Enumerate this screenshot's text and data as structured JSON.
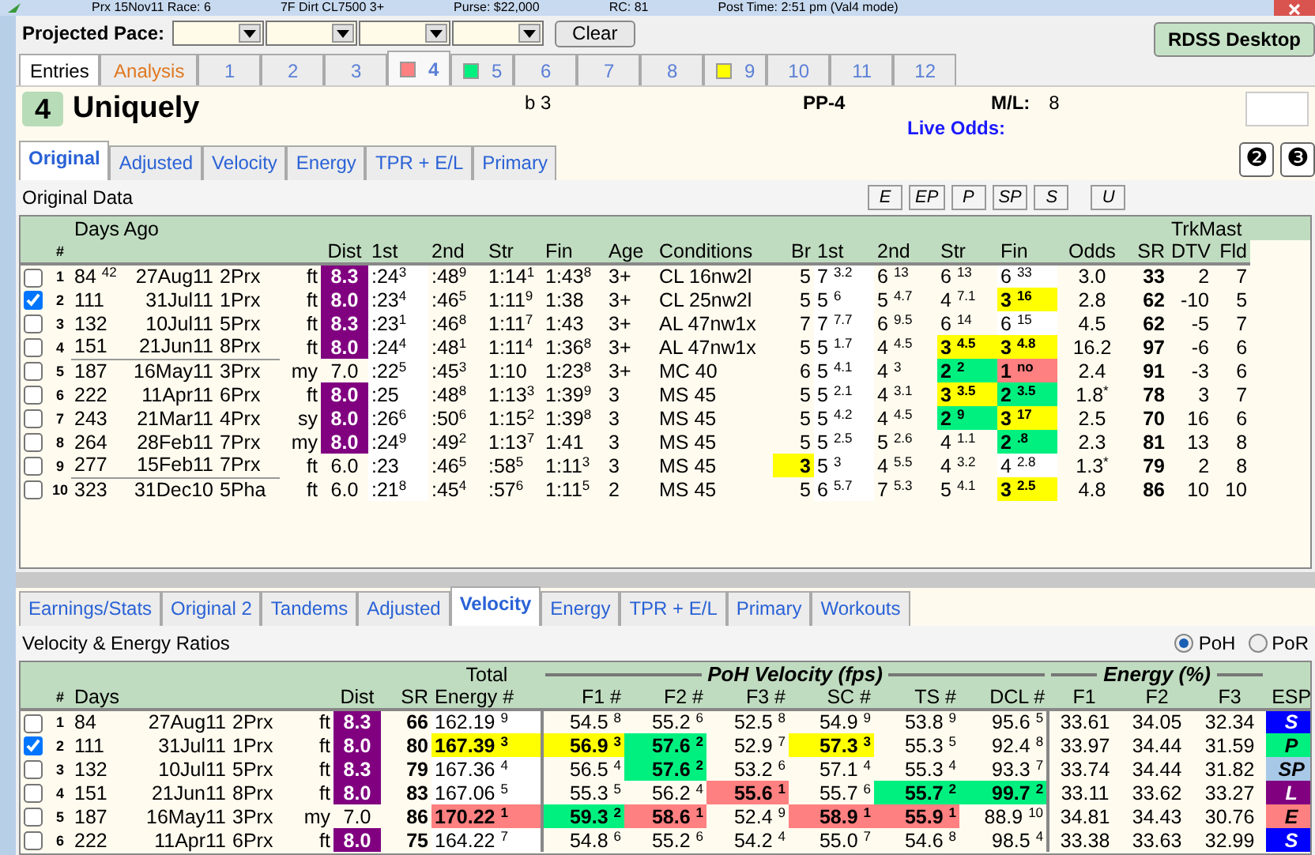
{
  "title_parts": [
    "Prx 15Nov11 Race: 6",
    "7F Dirt  CL7500  3+",
    "Purse: $22,000",
    "RC: 81",
    "Post Time: 2:51 pm  (Val4 mode)"
  ],
  "pace": {
    "label": "Projected Pace:",
    "clear": "Clear"
  },
  "desktop_button": "RDSS Desktop",
  "tabs": [
    {
      "label": "Entries",
      "kind": "plain",
      "selected": false
    },
    {
      "label": "Analysis",
      "kind": "analysis",
      "selected": false
    },
    {
      "label": "1",
      "kind": "horse",
      "selected": false
    },
    {
      "label": "2",
      "kind": "horse",
      "selected": false
    },
    {
      "label": "3",
      "kind": "horse",
      "selected": false
    },
    {
      "label": "4",
      "kind": "horse",
      "selected": true,
      "color": "#ff8080"
    },
    {
      "label": "5",
      "kind": "horse",
      "selected": false,
      "color": "#00f080"
    },
    {
      "label": "6",
      "kind": "horse",
      "selected": false
    },
    {
      "label": "7",
      "kind": "horse",
      "selected": false
    },
    {
      "label": "8",
      "kind": "horse",
      "selected": false
    },
    {
      "label": "9",
      "kind": "horse",
      "selected": false,
      "color": "#ffff00"
    },
    {
      "label": "10",
      "kind": "horse",
      "selected": false
    },
    {
      "label": "11",
      "kind": "horse",
      "selected": false
    },
    {
      "label": "12",
      "kind": "horse",
      "selected": false
    }
  ],
  "horse": {
    "number": "4",
    "name": "Uniquely",
    "sex_age": "b 3",
    "post": "PP-4",
    "ml_label": "M/L:",
    "ml": "8",
    "live_odds_label": "Live Odds:",
    "buttons": [
      "❷",
      "❸"
    ]
  },
  "upper_tabs": [
    {
      "label": "Original",
      "selected": true
    },
    {
      "label": "Adjusted",
      "selected": false
    },
    {
      "label": "Velocity",
      "selected": false
    },
    {
      "label": "Energy",
      "selected": false
    },
    {
      "label": "TPR + E/L",
      "selected": false
    },
    {
      "label": "Primary",
      "selected": false
    }
  ],
  "upper_title": "Original Data",
  "filter_buttons": [
    "E",
    "EP",
    "P",
    "SP",
    "S",
    "U"
  ],
  "upper_table": {
    "days_label": "Days Ago",
    "group_label": "TrkMast",
    "columns": [
      "#",
      "",
      "",
      "",
      "",
      "Dist",
      "1st",
      "2nd",
      "Str",
      "Fin",
      "Age",
      "Conditions",
      "Br",
      "1st",
      "2nd",
      "Str",
      "Fin",
      "Odds",
      "SR",
      "DTV",
      "Fld"
    ],
    "rows": [
      {
        "checked": false,
        "rule_below": false,
        "cells": [
          "1",
          "84 $^{42}$",
          "27Aug11",
          "2Prx",
          "ft",
          {
            "text": "8.3",
            "color": "#800080"
          },
          ":24$^{3}$",
          ":48$^{9}$",
          "1:14$^{1}$",
          "1:43$^{8}$",
          "3+",
          "CL 16nw2l",
          "5",
          "7 $^{3.2}$",
          "6 $^{13}$",
          "6 $^{13}$",
          "6 $^{33}$",
          "3.0",
          "33",
          "2",
          "7"
        ]
      },
      {
        "checked": true,
        "rule_below": false,
        "cells": [
          "2",
          "111",
          "31Jul11",
          "1Prx",
          "ft",
          {
            "text": "8.0",
            "color": "#800080"
          },
          ":23$^{4}$",
          ":46$^{5}$",
          "1:11$^{9}$",
          "1:38",
          "3+",
          "CL 25nw2l",
          "5",
          "5 $^{6}$",
          "5 $^{4.7}$",
          "4 $^{7.1}$",
          {
            "text": "3 $^{16}$",
            "color": "#ffff00"
          },
          "2.8",
          "62",
          "-10",
          "5"
        ]
      },
      {
        "checked": false,
        "rule_below": false,
        "cells": [
          "3",
          "132",
          "10Jul11",
          "5Prx",
          "ft",
          {
            "text": "8.3",
            "color": "#800080"
          },
          ":23$^{1}$",
          ":46$^{8}$",
          "1:11$^{7}$",
          "1:43",
          "3+",
          "AL 47nw1x",
          "7",
          "7 $^{7.7}$",
          "6 $^{9.5}$",
          "6 $^{14}$",
          "6 $^{15}$",
          "4.5",
          "62",
          "-5",
          "7"
        ]
      },
      {
        "checked": false,
        "rule_below": true,
        "cells": [
          "4",
          "151",
          "21Jun11",
          "8Prx",
          "ft",
          {
            "text": "8.0",
            "color": "#800080"
          },
          ":24$^{4}$",
          ":48$^{1}$",
          "1:11$^{4}$",
          "1:36$^{8}$",
          "3+",
          "AL 47nw1x",
          "5",
          "5 $^{1.7}$",
          "4 $^{4.5}$",
          {
            "text": "3 $^{4.5}$",
            "color": "#ffff00"
          },
          {
            "text": "3 $^{4.8}$",
            "color": "#ffff00"
          },
          "16.2",
          "97",
          "-6",
          "6"
        ]
      },
      {
        "checked": false,
        "rule_below": false,
        "cells": [
          "5",
          "187",
          "16May11",
          "3Prx",
          "my",
          "7.0",
          ":22$^{5}$",
          ":45$^{3}$",
          "1:10",
          "1:23$^{8}$",
          "3+",
          "MC 40",
          "6",
          "5 $^{4.1}$",
          "4 $^{3}$",
          {
            "text": "2 $^{2}$",
            "color": "#00f080"
          },
          {
            "text": "1 $^{no}$",
            "color": "#ff8080"
          },
          "2.4",
          "91",
          "-3",
          "6"
        ]
      },
      {
        "checked": false,
        "rule_below": false,
        "cells": [
          "6",
          "222",
          "11Apr11",
          "6Prx",
          "ft",
          {
            "text": "8.0",
            "color": "#800080"
          },
          ":25",
          ":48$^{8}$",
          "1:13$^{3}$",
          "1:39$^{9}$",
          "3",
          "MS 45",
          "5",
          "5 $^{2.1}$",
          "4 $^{3.1}$",
          {
            "text": "3 $^{3.5}$",
            "color": "#ffff00"
          },
          {
            "text": "2 $^{3.5}$",
            "color": "#00f080"
          },
          "1.8$^{*}$",
          "78",
          "3",
          "7"
        ]
      },
      {
        "checked": false,
        "rule_below": false,
        "cells": [
          "7",
          "243",
          "21Mar11",
          "4Prx",
          "sy",
          {
            "text": "8.0",
            "color": "#800080"
          },
          ":26$^{6}$",
          ":50$^{6}$",
          "1:15$^{2}$",
          "1:39$^{8}$",
          "3",
          "MS 45",
          "5",
          "5 $^{4.2}$",
          "4 $^{4.5}$",
          {
            "text": "2 $^{9}$",
            "color": "#00f080"
          },
          {
            "text": "3 $^{17}$",
            "color": "#ffff00"
          },
          "2.5",
          "70",
          "16",
          "6"
        ]
      },
      {
        "checked": false,
        "rule_below": false,
        "cells": [
          "8",
          "264",
          "28Feb11",
          "7Prx",
          "my",
          {
            "text": "8.0",
            "color": "#800080"
          },
          ":24$^{9}$",
          ":49$^{2}$",
          "1:13$^{7}$",
          "1:41",
          "3",
          "MS 45",
          "5",
          "5 $^{2.5}$",
          "5 $^{2.6}$",
          "4 $^{1.1}$",
          {
            "text": "2 $^{.8}$",
            "color": "#00f080"
          },
          "2.3",
          "81",
          "13",
          "8"
        ]
      },
      {
        "checked": false,
        "rule_below": true,
        "cells": [
          "9",
          "277",
          "15Feb11",
          "7Prx",
          "ft",
          "6.0",
          ":23",
          ":46$^{5}$",
          ":58$^{5}$",
          "1:11$^{3}$",
          "3",
          "MS 45",
          {
            "text": "3",
            "color": "#ffff00"
          },
          "5 $^{3}$",
          "4 $^{5.5}$",
          "4 $^{3.2}$",
          "4 $^{2.8}$",
          "1.3$^{*}$",
          "79",
          "2",
          "8"
        ]
      },
      {
        "checked": false,
        "rule_below": false,
        "cells": [
          "10",
          "323",
          "31Dec10",
          "5Pha",
          "ft",
          "6.0",
          ":21$^{8}$",
          ":45$^{4}$",
          ":57$^{6}$",
          "1:11$^{5}$",
          "2",
          "MS 45",
          "5",
          "6 $^{5.7}$",
          "7 $^{5.3}$",
          "5 $^{4.1}$",
          {
            "text": "3 $^{2.5}$",
            "color": "#ffff00"
          },
          "4.8",
          "86",
          "10",
          "10"
        ]
      }
    ]
  },
  "lower_tabs": [
    {
      "label": "Earnings/Stats",
      "selected": false
    },
    {
      "label": "Original 2",
      "selected": false
    },
    {
      "label": "Tandems",
      "selected": false
    },
    {
      "label": "Adjusted",
      "selected": false
    },
    {
      "label": "Velocity",
      "selected": true
    },
    {
      "label": "Energy",
      "selected": false
    },
    {
      "label": "TPR + E/L",
      "selected": false
    },
    {
      "label": "Primary",
      "selected": false
    },
    {
      "label": "Workouts",
      "selected": false
    }
  ],
  "lower_title": "Velocity & Energy Ratios",
  "radios": [
    {
      "label": "PoH",
      "selected": true
    },
    {
      "label": "PoR",
      "selected": false
    }
  ],
  "lower_table": {
    "groups": [
      "Total",
      "PoH Velocity (fps)",
      "Energy (%)"
    ],
    "columns": [
      "#",
      "Days",
      "",
      "",
      "",
      "Dist",
      "SR",
      "Energy #",
      "F1 #",
      "F2 #",
      "F3 #",
      "SC #",
      "TS #",
      "DCL #",
      "F1",
      "F2",
      "F3",
      "ESP"
    ],
    "rows": [
      {
        "checked": false,
        "cells": [
          "1",
          "84",
          "27Aug11",
          "2Prx",
          "ft",
          {
            "text": "8.3",
            "color": "#800080"
          },
          "66",
          "162.19 $^{9}$",
          "54.5 $^{8}$",
          "55.2 $^{6}$",
          "52.5 $^{8}$",
          "54.9 $^{9}$",
          "53.8 $^{9}$",
          "95.6 $^{5}$",
          "33.61",
          "34.05",
          "32.34",
          {
            "text": "S",
            "color": "#0000ff"
          }
        ]
      },
      {
        "checked": true,
        "cells": [
          "2",
          "111",
          "31Jul11",
          "1Prx",
          "ft",
          {
            "text": "8.0",
            "color": "#800080"
          },
          "80",
          {
            "text": "167.39 $^{3}$",
            "color": "#ffff00"
          },
          {
            "text": "56.9 $^{3}$",
            "color": "#ffff00"
          },
          {
            "text": "57.6 $^{2}$",
            "color": "#00f080"
          },
          "52.9 $^{7}$",
          {
            "text": "57.3 $^{3}$",
            "color": "#ffff00"
          },
          "55.3 $^{5}$",
          "92.4 $^{8}$",
          "33.97",
          "34.44",
          "31.59",
          {
            "text": "P",
            "color": "#00f080"
          }
        ]
      },
      {
        "checked": false,
        "cells": [
          "3",
          "132",
          "10Jul11",
          "5Prx",
          "ft",
          {
            "text": "8.3",
            "color": "#800080"
          },
          "79",
          "167.36 $^{4}$",
          "56.5 $^{4}$",
          {
            "text": "57.6 $^{2}$",
            "color": "#00f080"
          },
          "53.2 $^{6}$",
          "57.1 $^{4}$",
          "55.3 $^{4}$",
          "93.3 $^{7}$",
          "33.74",
          "34.44",
          "31.82",
          {
            "text": "SP",
            "color": "#a8c8e8"
          }
        ]
      },
      {
        "checked": false,
        "cells": [
          "4",
          "151",
          "21Jun11",
          "8Prx",
          "ft",
          {
            "text": "8.0",
            "color": "#800080"
          },
          "83",
          "167.06 $^{5}$",
          "55.3 $^{5}$",
          "56.2 $^{4}$",
          {
            "text": "55.6 $^{1}$",
            "color": "#ff8080"
          },
          "55.7 $^{6}$",
          {
            "text": "55.7 $^{2}$",
            "color": "#00f080"
          },
          {
            "text": "99.7 $^{2}$",
            "color": "#00f080"
          },
          "33.11",
          "33.62",
          "33.27",
          {
            "text": "L",
            "color": "#800080"
          }
        ]
      },
      {
        "checked": false,
        "cells": [
          "5",
          "187",
          "16May11",
          "3Prx",
          "my",
          "7.0",
          "86",
          {
            "text": "170.22 $^{1}$",
            "color": "#ff8080"
          },
          {
            "text": "59.3 $^{2}$",
            "color": "#00f080"
          },
          {
            "text": "58.6 $^{1}$",
            "color": "#ff8080"
          },
          "52.4 $^{9}$",
          {
            "text": "58.9 $^{1}$",
            "color": "#ff8080"
          },
          {
            "text": "55.9 $^{1}$",
            "color": "#ff8080"
          },
          "88.9 $^{10}$",
          "34.81",
          "34.43",
          "30.76",
          {
            "text": "E",
            "color": "#ff8080"
          }
        ]
      },
      {
        "checked": false,
        "cells": [
          "6",
          "222",
          "11Apr11",
          "6Prx",
          "ft",
          {
            "text": "8.0",
            "color": "#800080"
          },
          "75",
          "164.22 $^{7}$",
          "54.8 $^{6}$",
          "55.2 $^{6}$",
          "54.2 $^{4}$",
          "55.0 $^{7}$",
          "54.6 $^{8}$",
          "98.5 $^{4}$",
          "33.38",
          "33.63",
          "32.99",
          {
            "text": "S",
            "color": "#0000ff"
          }
        ]
      }
    ]
  }
}
